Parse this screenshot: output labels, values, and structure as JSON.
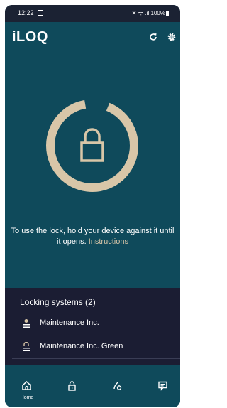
{
  "status_bar": {
    "time": "12:22",
    "right_indicators": "✕ ᯤ .ıl 100%"
  },
  "header": {
    "logo": "iLOQ",
    "refresh_icon": "refresh-icon",
    "settings_icon": "gear-icon"
  },
  "main": {
    "instruction_text": "To use the lock, hold your device against it until it opens.",
    "instruction_link": "Instructions"
  },
  "locking_systems": {
    "title": "Locking systems (2)",
    "items": [
      {
        "label": "Maintenance Inc.",
        "icon": "building-icon"
      },
      {
        "label": "Maintenance Inc. Green",
        "icon": "building-icon"
      }
    ]
  },
  "bottom_nav": {
    "items": [
      {
        "label": "Home",
        "icon": "home-icon",
        "active": true
      },
      {
        "label": "",
        "icon": "lock-icon",
        "active": false
      },
      {
        "label": "",
        "icon": "key-icon",
        "active": false
      },
      {
        "label": "",
        "icon": "message-icon",
        "active": false
      }
    ]
  },
  "colors": {
    "background": "#0f4a5b",
    "panel": "#1b1d33",
    "accent": "#d8c6a8",
    "text": "#ffffff"
  }
}
